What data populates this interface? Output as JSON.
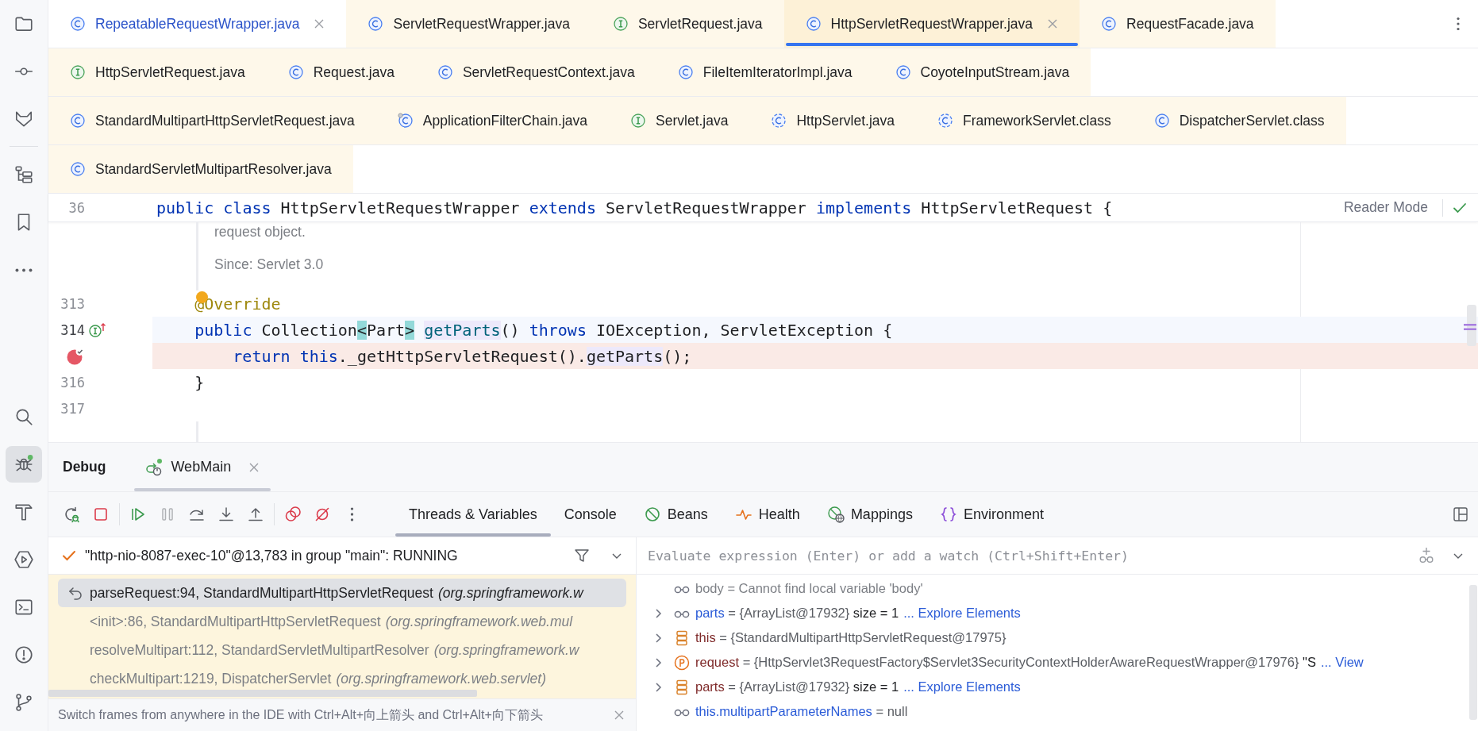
{
  "tool_rail": {
    "top": [
      {
        "kind": "project",
        "selected": false
      },
      {
        "kind": "commit",
        "selected": false
      },
      {
        "kind": "cat",
        "selected": false
      },
      {
        "kind": "structure",
        "selected": false
      },
      {
        "kind": "bookmarks",
        "selected": false
      },
      {
        "kind": "more",
        "selected": false
      }
    ],
    "bottom": [
      {
        "kind": "search",
        "selected": false
      },
      {
        "kind": "debug",
        "selected": true
      },
      {
        "kind": "build",
        "selected": false
      },
      {
        "kind": "services",
        "selected": false
      },
      {
        "kind": "terminal",
        "selected": false
      },
      {
        "kind": "problems",
        "selected": false
      },
      {
        "kind": "git",
        "selected": false
      }
    ]
  },
  "tab_rows": [
    [
      {
        "label": "RepeatableRequestWrapper.java",
        "kind": "class",
        "selected": false,
        "modified": true,
        "library": false,
        "close_button": true
      },
      {
        "label": "ServletRequestWrapper.java",
        "kind": "class",
        "selected": false,
        "modified": false,
        "library": true,
        "close_button": false
      },
      {
        "label": "ServletRequest.java",
        "kind": "interface",
        "selected": false,
        "modified": false,
        "library": true,
        "close_button": false
      },
      {
        "label": "HttpServletRequestWrapper.java",
        "kind": "class",
        "selected": true,
        "modified": false,
        "library": true,
        "close_button": true
      },
      {
        "label": "RequestFacade.java",
        "kind": "class",
        "selected": false,
        "modified": false,
        "library": true,
        "close_button": false
      }
    ],
    [
      {
        "label": "HttpServletRequest.java",
        "kind": "interface",
        "selected": false,
        "modified": false,
        "library": true,
        "close_button": false
      },
      {
        "label": "Request.java",
        "kind": "class",
        "selected": false,
        "modified": false,
        "library": true,
        "close_button": false
      },
      {
        "label": "ServletRequestContext.java",
        "kind": "class",
        "selected": false,
        "modified": false,
        "library": true,
        "close_button": false
      },
      {
        "label": "FileItemIteratorImpl.java",
        "kind": "class",
        "selected": false,
        "modified": false,
        "library": true,
        "close_button": false
      },
      {
        "label": "CoyoteInputStream.java",
        "kind": "class",
        "selected": false,
        "modified": false,
        "library": true,
        "close_button": false
      }
    ],
    [
      {
        "label": "StandardMultipartHttpServletRequest.java",
        "kind": "class",
        "selected": false,
        "modified": false,
        "library": true,
        "close_button": false
      },
      {
        "label": "ApplicationFilterChain.java",
        "kind": "class-linked",
        "selected": false,
        "modified": false,
        "library": true,
        "close_button": false
      },
      {
        "label": "Servlet.java",
        "kind": "interface",
        "selected": false,
        "modified": false,
        "library": true,
        "close_button": false
      },
      {
        "label": "HttpServlet.java",
        "kind": "class-dashed",
        "selected": false,
        "modified": false,
        "library": true,
        "close_button": false
      },
      {
        "label": "FrameworkServlet.class",
        "kind": "class-dashed",
        "selected": false,
        "modified": false,
        "library": true,
        "close_button": false
      },
      {
        "label": "DispatcherServlet.class",
        "kind": "class",
        "selected": false,
        "modified": false,
        "library": true,
        "close_button": false
      }
    ],
    [
      {
        "label": "StandardServletMultipartResolver.java",
        "kind": "class",
        "selected": false,
        "modified": false,
        "library": true,
        "close_button": false
      }
    ]
  ],
  "editor": {
    "sticky_line": {
      "number": "36",
      "tokens": [
        {
          "kind": "keyword",
          "text": "public"
        },
        {
          "kind": "keyword",
          "text": " class"
        },
        {
          "kind": "plain",
          "text": " HttpServletRequestWrapper "
        },
        {
          "kind": "keyword",
          "text": "extends"
        },
        {
          "kind": "plain",
          "text": " ServletRequestWrapper "
        },
        {
          "kind": "keyword",
          "text": "implements"
        },
        {
          "kind": "plain",
          "text": " HttpServletRequest {"
        }
      ]
    },
    "reader_mode": "Reader Mode",
    "doc": [
      "request object.",
      "Since: Servlet 3.0"
    ],
    "lines": [
      {
        "number": "313",
        "kind": "plain",
        "current": false,
        "breakpoint": false,
        "intention": true,
        "tokens": [
          {
            "kind": "annotation",
            "text": "    @Override"
          }
        ]
      },
      {
        "number": "314",
        "kind": "implements",
        "current": true,
        "breakpoint": false,
        "intention": false,
        "tokens": [
          {
            "kind": "keyword",
            "text": "    public"
          },
          {
            "kind": "plain",
            "text": " Collection"
          },
          {
            "kind": "brace-match",
            "text": "<"
          },
          {
            "kind": "plain",
            "text": "Part"
          },
          {
            "kind": "brace-match",
            "text": ">"
          },
          {
            "kind": "decl-usage",
            "text": " getParts"
          },
          {
            "kind": "plain",
            "text": "()"
          },
          {
            "kind": "keyword",
            "text": " throws"
          },
          {
            "kind": "plain",
            "text": " IOException, ServletException {"
          }
        ]
      },
      {
        "kind": "breakpoint",
        "current": false,
        "breakpoint": true,
        "intention": false,
        "tokens": [
          {
            "kind": "keyword",
            "text": "        return"
          },
          {
            "kind": "keyword",
            "text": " this"
          },
          {
            "kind": "plain",
            "text": "._getHttpServletRequest()."
          },
          {
            "kind": "usage",
            "text": "getParts"
          },
          {
            "kind": "plain",
            "text": "();"
          }
        ]
      },
      {
        "number": "316",
        "kind": "plain",
        "current": false,
        "breakpoint": false,
        "intention": false,
        "tokens": [
          {
            "kind": "plain",
            "text": "    }"
          }
        ]
      },
      {
        "number": "317",
        "kind": "plain",
        "current": false,
        "breakpoint": false,
        "intention": false
      }
    ]
  },
  "debug": {
    "title": "Debug",
    "session": {
      "label": "WebMain",
      "selected": true
    },
    "toolbar_groups": [
      [
        {
          "kind": "rerun",
          "disabled": false
        },
        {
          "kind": "stop",
          "disabled": false
        }
      ],
      [
        {
          "kind": "resume",
          "disabled": false
        },
        {
          "kind": "pause",
          "disabled": true
        },
        {
          "kind": "step-over",
          "disabled": false
        },
        {
          "kind": "step-into",
          "disabled": false
        },
        {
          "kind": "step-out",
          "disabled": false
        }
      ],
      [
        {
          "kind": "breakpoints",
          "disabled": false
        },
        {
          "kind": "mute",
          "disabled": false
        },
        {
          "kind": "more",
          "disabled": false
        }
      ]
    ],
    "tabs": [
      {
        "label": "Threads & Variables",
        "kind": "plain",
        "selected": true
      },
      {
        "label": "Console",
        "kind": "plain",
        "selected": false
      },
      {
        "label": "Beans",
        "kind": "beans",
        "selected": false
      },
      {
        "label": "Health",
        "kind": "health",
        "selected": false
      },
      {
        "label": "Mappings",
        "kind": "mappings",
        "selected": false
      },
      {
        "label": "Environment",
        "kind": "environment",
        "selected": false
      }
    ],
    "thread": "\"http-nio-8087-exec-10\"@13,783 in group \"main\": RUNNING",
    "frames": [
      {
        "method": "parseRequest:94, StandardMultipartHttpServletRequest",
        "package": "(org.springframework.w",
        "selected": true
      },
      {
        "method": "<init>:86, StandardMultipartHttpServletRequest",
        "package": "(org.springframework.web.mul",
        "selected": false
      },
      {
        "method": "resolveMultipart:112, StandardServletMultipartResolver",
        "package": "(org.springframework.w",
        "selected": false
      },
      {
        "method": "checkMultipart:1219, DispatcherServlet",
        "package": "(org.springframework.web.servlet)",
        "selected": false
      }
    ],
    "hint": "Switch frames from anywhere in the IDE with Ctrl+Alt+向上箭头 and Ctrl+Alt+向下箭头",
    "evaluate": {
      "placeholder": "Evaluate expression (Enter) or add a watch (Ctrl+Shift+Enter)"
    },
    "variables": [
      {
        "kind": "watch",
        "expandable": false,
        "error": true,
        "name": "body",
        "value": "= Cannot find local variable 'body'"
      },
      {
        "kind": "watch",
        "expandable": true,
        "error": false,
        "name": "parts",
        "value": "= {ArrayList@17932}",
        "extra": "size = 1",
        "link": "... Explore Elements"
      },
      {
        "kind": "field",
        "expandable": true,
        "error": false,
        "name": "this",
        "value": "= {StandardMultipartHttpServletRequest@17975}"
      },
      {
        "kind": "parameter",
        "expandable": true,
        "error": false,
        "name": "request",
        "value": "= {HttpServlet3RequestFactory$Servlet3SecurityContextHolderAwareRequestWrapper@17976}",
        "extra": "\"S",
        "link": "... View"
      },
      {
        "kind": "field",
        "expandable": true,
        "error": false,
        "name": "parts",
        "value": "= {ArrayList@17932}",
        "extra": "size = 1",
        "link": "... Explore Elements"
      },
      {
        "kind": "watch",
        "expandable": false,
        "error": false,
        "name": "this.multipartParameterNames",
        "value": "= null"
      }
    ]
  }
}
